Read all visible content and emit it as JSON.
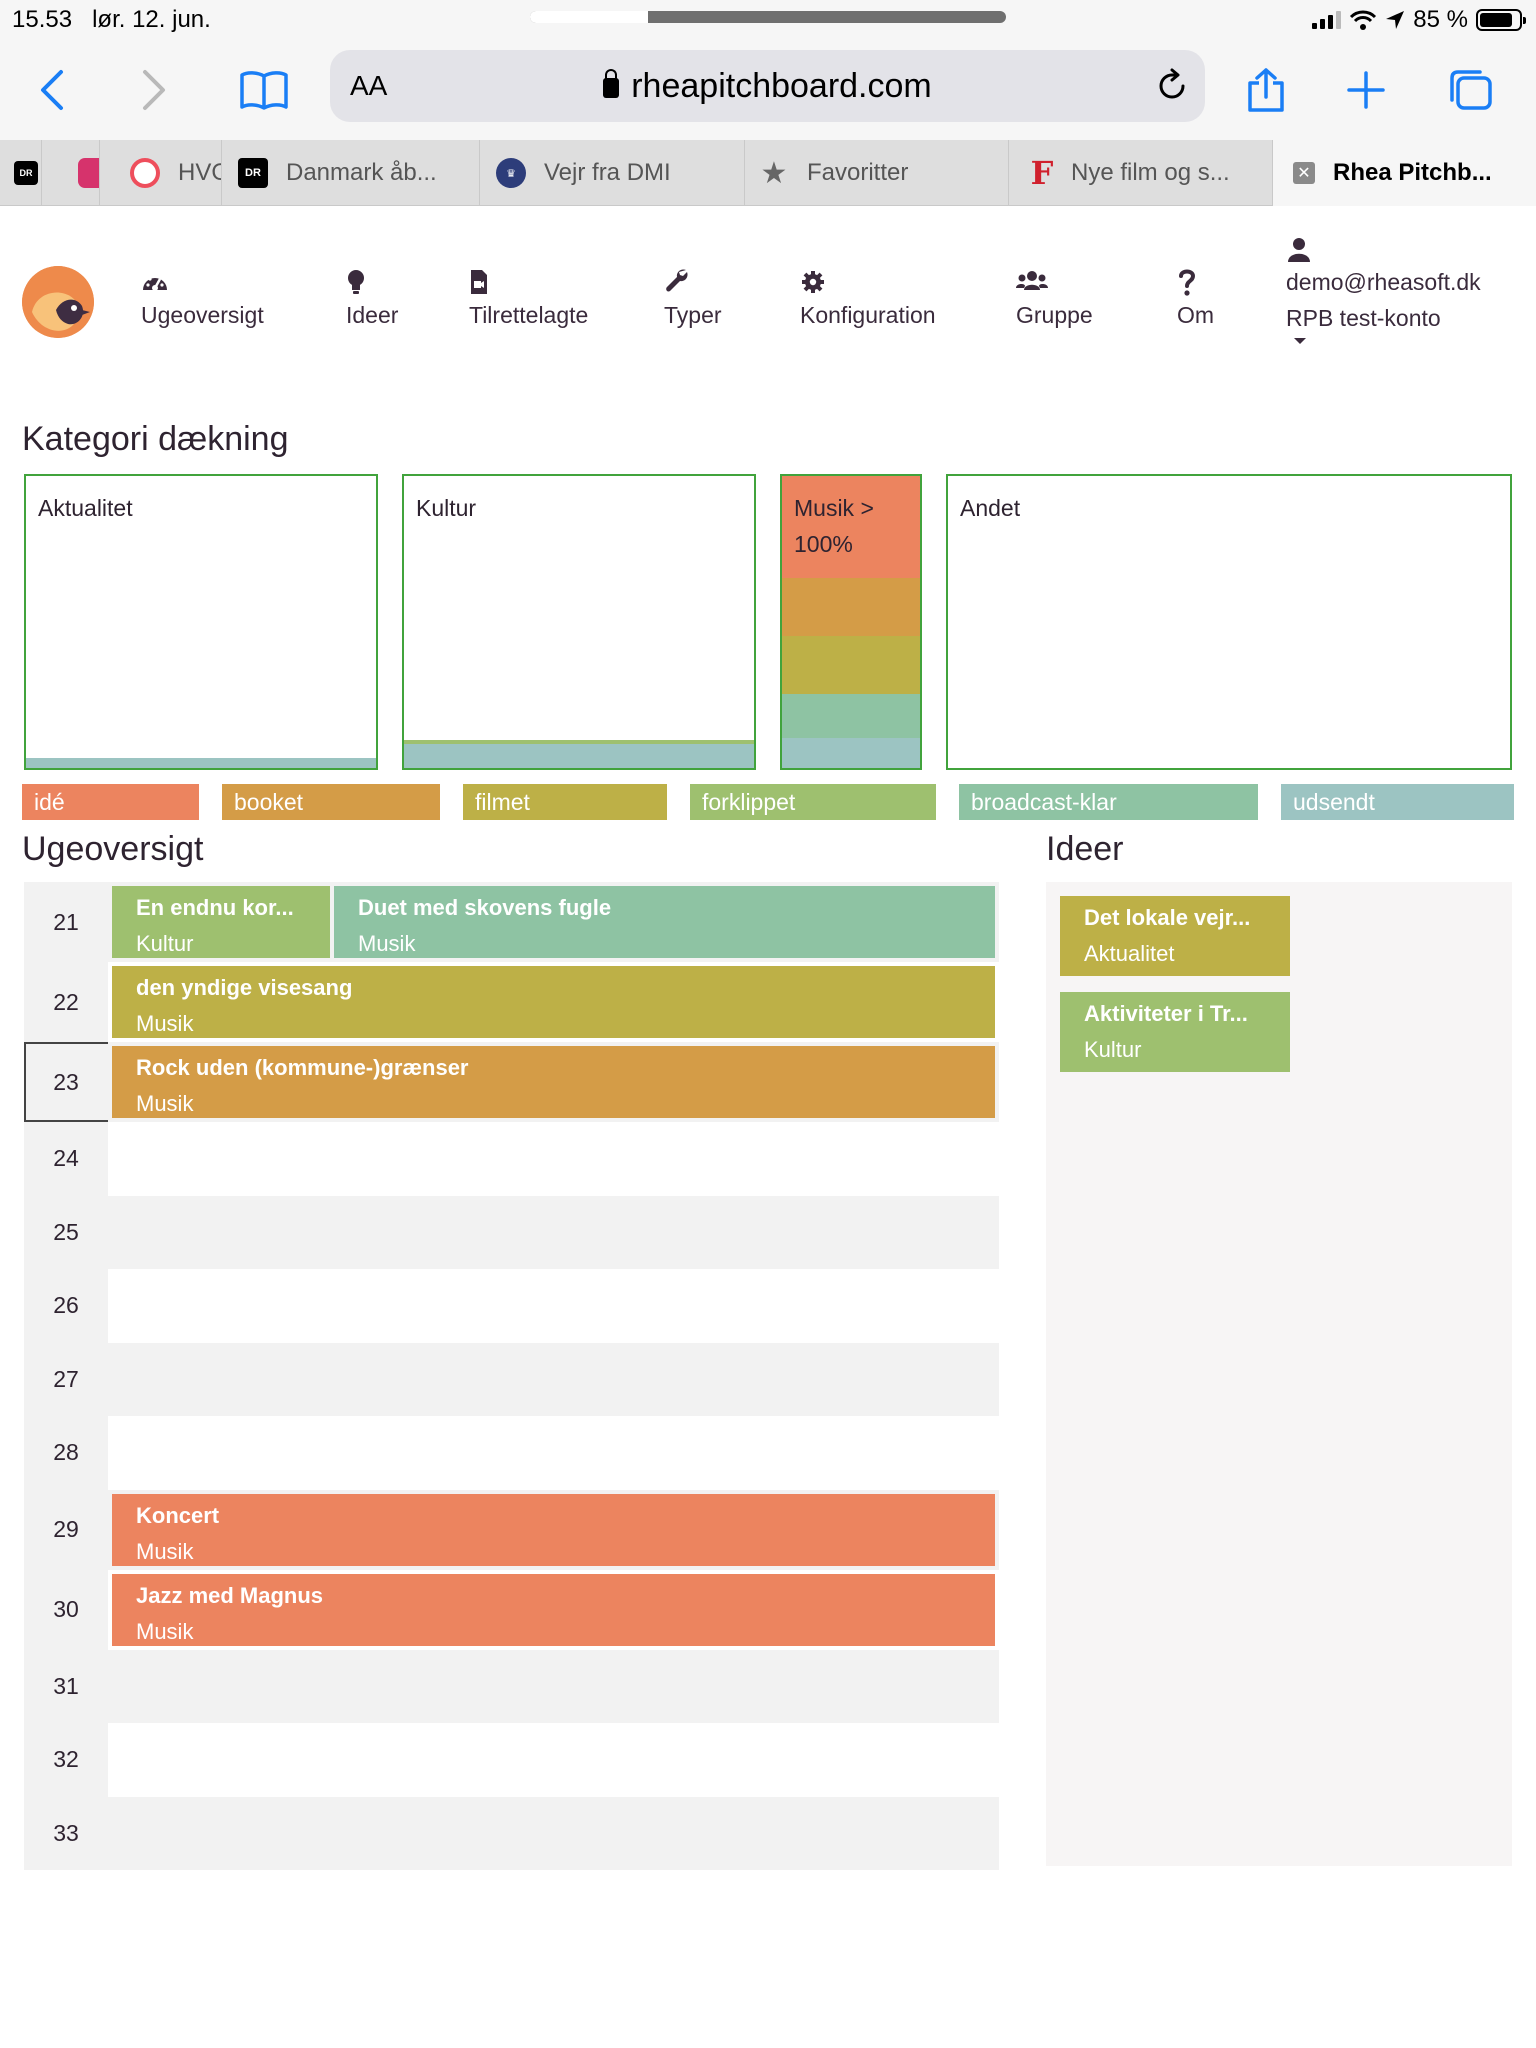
{
  "status": {
    "time": "15.53",
    "date": "lør. 12. jun.",
    "battery": "85 %",
    "battery_level": 0.85
  },
  "browser": {
    "aa": "AA",
    "url": "rheapitchboard.com",
    "tabs": [
      {
        "label": "",
        "favicon": "DR"
      },
      {
        "label": "",
        "favicon": "instagram-icon"
      },
      {
        "label": "HVO",
        "favicon": "target-icon"
      },
      {
        "label": "Danmark åb...",
        "favicon": "DR"
      },
      {
        "label": "Vejr fra DMI",
        "favicon": "crown-icon"
      },
      {
        "label": "Favoritter",
        "favicon": "star-icon"
      },
      {
        "label": "Nye film og s...",
        "favicon": "F"
      },
      {
        "label": "Rhea Pitchb...",
        "favicon": "close-icon"
      }
    ]
  },
  "nav": {
    "items": [
      {
        "label": "Ugeoversigt",
        "icon": "dashboard-icon"
      },
      {
        "label": "Ideer",
        "icon": "lightbulb-icon"
      },
      {
        "label": "Tilrettelagte",
        "icon": "file-video-icon"
      },
      {
        "label": "Typer",
        "icon": "wrench-icon"
      },
      {
        "label": "Konfiguration",
        "icon": "gear-icon"
      },
      {
        "label": "Gruppe",
        "icon": "users-icon"
      },
      {
        "label": "Om",
        "icon": "question-icon"
      }
    ],
    "user": {
      "email": "demo@rheasoft.dk",
      "account": "RPB test-konto"
    }
  },
  "coverage": {
    "title": "Kategori dækning",
    "categories": [
      {
        "label": "Aktualitet"
      },
      {
        "label": "Kultur"
      },
      {
        "label": "Musik >",
        "sub": "100%"
      },
      {
        "label": "Andet"
      }
    ]
  },
  "legend": [
    {
      "label": "idé",
      "color": "#ec845f"
    },
    {
      "label": "booket",
      "color": "#d49c47"
    },
    {
      "label": "filmet",
      "color": "#bdb047"
    },
    {
      "label": "forklippet",
      "color": "#9ec06f"
    },
    {
      "label": "broadcast-klar",
      "color": "#8ec3a3"
    },
    {
      "label": "udsendt",
      "color": "#9cc4c2"
    }
  ],
  "week": {
    "title": "Ugeoversigt",
    "rows": [
      {
        "week": "21",
        "pitches": [
          {
            "title": "En endnu kor...",
            "category": "Kultur",
            "color": "#9ec06f"
          },
          {
            "title": "Duet med skovens fugle",
            "category": "Musik",
            "color": "#8ec3a3"
          }
        ]
      },
      {
        "week": "22",
        "pitches": [
          {
            "title": "den yndige visesang",
            "category": "Musik",
            "color": "#bdb047"
          }
        ]
      },
      {
        "week": "23",
        "pitches": [
          {
            "title": "Rock uden (kommune-)grænser",
            "category": "Musik",
            "color": "#d49c47"
          }
        ]
      },
      {
        "week": "24",
        "pitches": []
      },
      {
        "week": "25",
        "pitches": []
      },
      {
        "week": "26",
        "pitches": []
      },
      {
        "week": "27",
        "pitches": []
      },
      {
        "week": "28",
        "pitches": []
      },
      {
        "week": "29",
        "pitches": [
          {
            "title": "Koncert",
            "category": "Musik",
            "color": "#ec845f"
          }
        ]
      },
      {
        "week": "30",
        "pitches": [
          {
            "title": "Jazz med Magnus",
            "category": "Musik",
            "color": "#ec845f"
          }
        ]
      },
      {
        "week": "31",
        "pitches": []
      },
      {
        "week": "32",
        "pitches": []
      },
      {
        "week": "33",
        "pitches": []
      }
    ]
  },
  "ideas": {
    "title": "Ideer",
    "items": [
      {
        "title": "Det lokale vejr...",
        "category": "Aktualitet",
        "color": "#bdb047"
      },
      {
        "title": "Aktiviteter i Tr...",
        "category": "Kultur",
        "color": "#9ec06f"
      }
    ]
  }
}
